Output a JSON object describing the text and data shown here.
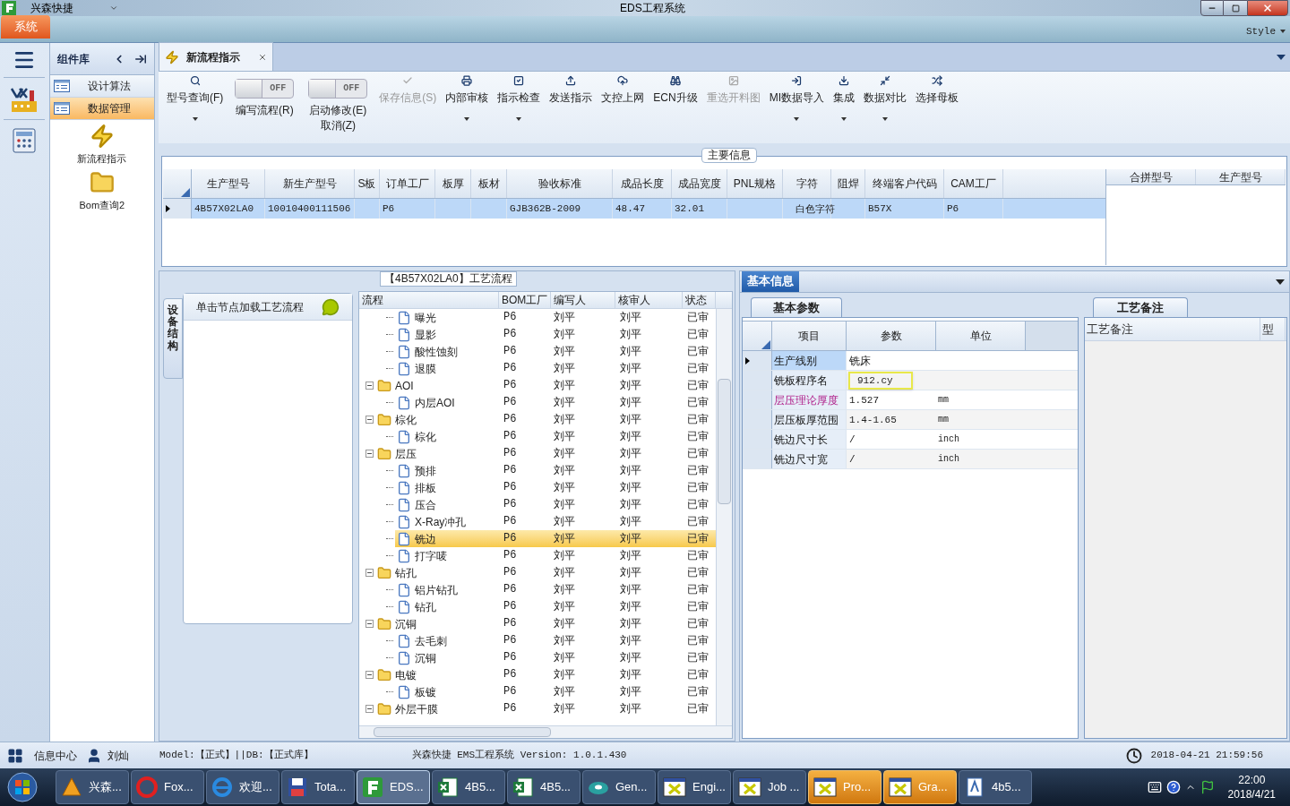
{
  "window": {
    "app_name": "兴森快捷",
    "title": "EDS工程系统",
    "style_menu": "Style"
  },
  "ribbon": {
    "tabs": [
      {
        "label": "系统",
        "selected": true
      }
    ]
  },
  "sidebar": {
    "title": "组件库",
    "items": [
      {
        "label": "设计算法",
        "selected": false
      },
      {
        "label": "数据管理",
        "selected": true
      }
    ],
    "launchers": [
      "新流程指示",
      "Bom查询2"
    ]
  },
  "doc_tabs": [
    {
      "label": "新流程指示",
      "selected": true
    }
  ],
  "toolbar": [
    {
      "kind": "button",
      "label": "型号查询(F)",
      "dropdown": true,
      "disabled": false
    },
    {
      "kind": "toggle",
      "on": false,
      "switch_text": "OFF",
      "lines": [
        "编写流程(R)"
      ]
    },
    {
      "kind": "toggle",
      "on": false,
      "switch_text": "OFF",
      "lines": [
        "启动修改(E)",
        "取消(Z)"
      ]
    },
    {
      "kind": "button",
      "label": "保存信息(S)",
      "dropdown": false,
      "disabled": true
    },
    {
      "kind": "button",
      "label": "内部审核",
      "dropdown": true,
      "disabled": false
    },
    {
      "kind": "button",
      "label": "指示检查",
      "dropdown": true,
      "disabled": false
    },
    {
      "kind": "button",
      "label": "发送指示",
      "dropdown": false,
      "disabled": false
    },
    {
      "kind": "button",
      "label": "文控上网",
      "dropdown": false,
      "disabled": false
    },
    {
      "kind": "button",
      "label": "ECN升级",
      "dropdown": false,
      "disabled": false
    },
    {
      "kind": "button",
      "label": "重选开料图",
      "dropdown": false,
      "disabled": true
    },
    {
      "kind": "button",
      "label": "MI数据导入",
      "dropdown": true,
      "disabled": false
    },
    {
      "kind": "button",
      "label": "集成",
      "dropdown": true,
      "disabled": false
    },
    {
      "kind": "button",
      "label": "数据对比",
      "dropdown": true,
      "disabled": false
    },
    {
      "kind": "button",
      "label": "选择母板",
      "dropdown": false,
      "disabled": false
    }
  ],
  "main_info": {
    "title": "主要信息",
    "row_selected": true,
    "columns": [
      {
        "label": "生产型号",
        "cell": "4B57X02LA0"
      },
      {
        "label": "新生产型号",
        "cell": "10010400111506"
      },
      {
        "label": "S板"
      },
      {
        "label": "订单工厂",
        "cell": "P6"
      },
      {
        "label": "板厚"
      },
      {
        "label": "板材"
      },
      {
        "label": "验收标准",
        "cell": "GJB362B-2009"
      },
      {
        "label": "成品长度",
        "cell": "48.47"
      },
      {
        "label": "成品宽度",
        "cell": "32.01"
      },
      {
        "label": "PNL规格"
      },
      {
        "label": "字符",
        "cell": "白色字符"
      },
      {
        "label": "阻焊"
      },
      {
        "label": "终端客户代码",
        "cell": "B57X"
      },
      {
        "label": "CAM工厂",
        "cell": "P6"
      }
    ],
    "side_columns": [
      "合拼型号",
      "生产型号"
    ]
  },
  "flow": {
    "title": "【4B57X02LA0】工艺流程",
    "side_tab": "设备结构",
    "hint": "单击节点加载工艺流程",
    "columns": [
      "流程",
      "BOM工厂",
      "编写人",
      "核审人",
      "状态"
    ],
    "tree": [
      {
        "children": [
          {
            "name": "曝光",
            "bom": "P6",
            "writer": "刘平",
            "reviewer": "刘平",
            "status": "已审",
            "selected": false
          },
          {
            "name": "显影",
            "bom": "P6",
            "writer": "刘平",
            "reviewer": "刘平",
            "status": "已审",
            "selected": false
          },
          {
            "name": "酸性蚀刻",
            "bom": "P6",
            "writer": "刘平",
            "reviewer": "刘平",
            "status": "已审",
            "selected": false
          },
          {
            "name": "退膜",
            "bom": "P6",
            "writer": "刘平",
            "reviewer": "刘平",
            "status": "已审",
            "selected": false
          }
        ]
      },
      {
        "name": "AOI",
        "bom": "P6",
        "writer": "刘平",
        "reviewer": "刘平",
        "status": "已审",
        "selected": false,
        "expanded": true,
        "children": [
          {
            "name": "内层AOI",
            "bom": "P6",
            "writer": "刘平",
            "reviewer": "刘平",
            "status": "已审",
            "selected": false
          }
        ]
      },
      {
        "name": "棕化",
        "bom": "P6",
        "writer": "刘平",
        "reviewer": "刘平",
        "status": "已审",
        "selected": false,
        "expanded": true,
        "children": [
          {
            "name": "棕化",
            "bom": "P6",
            "writer": "刘平",
            "reviewer": "刘平",
            "status": "已审",
            "selected": false
          }
        ]
      },
      {
        "name": "层压",
        "bom": "P6",
        "writer": "刘平",
        "reviewer": "刘平",
        "status": "已审",
        "selected": false,
        "expanded": true,
        "children": [
          {
            "name": "预排",
            "bom": "P6",
            "writer": "刘平",
            "reviewer": "刘平",
            "status": "已审",
            "selected": false
          },
          {
            "name": "排板",
            "bom": "P6",
            "writer": "刘平",
            "reviewer": "刘平",
            "status": "已审",
            "selected": false
          },
          {
            "name": "压合",
            "bom": "P6",
            "writer": "刘平",
            "reviewer": "刘平",
            "status": "已审",
            "selected": false
          },
          {
            "name": "X-Ray冲孔",
            "bom": "P6",
            "writer": "刘平",
            "reviewer": "刘平",
            "status": "已审",
            "selected": false
          },
          {
            "name": "铣边",
            "bom": "P6",
            "writer": "刘平",
            "reviewer": "刘平",
            "status": "已审",
            "selected": true
          },
          {
            "name": "打字唛",
            "bom": "P6",
            "writer": "刘平",
            "reviewer": "刘平",
            "status": "已审",
            "selected": false
          }
        ]
      },
      {
        "name": "钻孔",
        "bom": "P6",
        "writer": "刘平",
        "reviewer": "刘平",
        "status": "已审",
        "selected": false,
        "expanded": true,
        "children": [
          {
            "name": "铝片钻孔",
            "bom": "P6",
            "writer": "刘平",
            "reviewer": "刘平",
            "status": "已审",
            "selected": false
          },
          {
            "name": "钻孔",
            "bom": "P6",
            "writer": "刘平",
            "reviewer": "刘平",
            "status": "已审",
            "selected": false
          }
        ]
      },
      {
        "name": "沉铜",
        "bom": "P6",
        "writer": "刘平",
        "reviewer": "刘平",
        "status": "已审",
        "selected": false,
        "expanded": true,
        "children": [
          {
            "name": "去毛刺",
            "bom": "P6",
            "writer": "刘平",
            "reviewer": "刘平",
            "status": "已审",
            "selected": false
          },
          {
            "name": "沉铜",
            "bom": "P6",
            "writer": "刘平",
            "reviewer": "刘平",
            "status": "已审",
            "selected": false
          }
        ]
      },
      {
        "name": "电镀",
        "bom": "P6",
        "writer": "刘平",
        "reviewer": "刘平",
        "status": "已审",
        "selected": false,
        "expanded": true,
        "children": [
          {
            "name": "板镀",
            "bom": "P6",
            "writer": "刘平",
            "reviewer": "刘平",
            "status": "已审",
            "selected": false
          }
        ]
      },
      {
        "name": "外层干膜",
        "bom": "P6",
        "writer": "刘平",
        "reviewer": "刘平",
        "status": "已审",
        "selected": false,
        "expanded": true
      }
    ]
  },
  "basic_info": {
    "tab": "基本信息",
    "subtab": "基本参数",
    "columns": [
      "项目",
      "参数",
      "单位"
    ],
    "rows": [
      {
        "item": "生产线别",
        "value": "铣床",
        "selected": true,
        "highlighted": false,
        "focused": false
      },
      {
        "item": "铣板程序名",
        "value": "912.cy",
        "selected": false,
        "highlighted": false,
        "focused": true
      },
      {
        "item": "层压理论厚度",
        "value": "1.527",
        "unit": "mm",
        "selected": false,
        "highlighted": true,
        "focused": false
      },
      {
        "item": "层压板厚范围",
        "value": "1.4-1.65",
        "unit": "mm",
        "selected": false,
        "highlighted": false,
        "focused": false
      },
      {
        "item": "铣边尺寸长",
        "value": "/",
        "unit": "inch",
        "selected": false,
        "highlighted": false,
        "focused": false
      },
      {
        "item": "铣边尺寸宽",
        "value": "/",
        "unit": "inch",
        "selected": false,
        "highlighted": false,
        "focused": false
      }
    ]
  },
  "remarks": {
    "tab": "工艺备注",
    "columns": [
      "工艺备注",
      "型"
    ]
  },
  "status_bar": {
    "message_center": "信息中心",
    "user": "刘灿",
    "model": "Model:【正式】||DB:【正式库】",
    "product": "兴森快捷 EMS工程系统 Version: 1.0.1.430",
    "datetime": "2018-04-21 21:59:56"
  },
  "taskbar": {
    "items": [
      {
        "label": "兴森...",
        "active": false,
        "highlighted": false
      },
      {
        "label": "Fox...",
        "active": false,
        "highlighted": false
      },
      {
        "label": "欢迎...",
        "active": false,
        "highlighted": false
      },
      {
        "label": "Tota...",
        "active": false,
        "highlighted": false
      },
      {
        "label": "EDS...",
        "active": true,
        "highlighted": false
      },
      {
        "label": "4B5...",
        "active": false,
        "highlighted": false
      },
      {
        "label": "4B5...",
        "active": false,
        "highlighted": false
      },
      {
        "label": "Gen...",
        "active": false,
        "highlighted": false
      },
      {
        "label": "Engi...",
        "active": false,
        "highlighted": false
      },
      {
        "label": "Job ...",
        "active": false,
        "highlighted": false
      },
      {
        "label": "Pro...",
        "active": false,
        "highlighted": true
      },
      {
        "label": "Gra...",
        "active": false,
        "highlighted": true
      },
      {
        "label": "4b5...",
        "active": false,
        "highlighted": false
      }
    ],
    "time": "22:00",
    "date": "2018/4/21"
  }
}
